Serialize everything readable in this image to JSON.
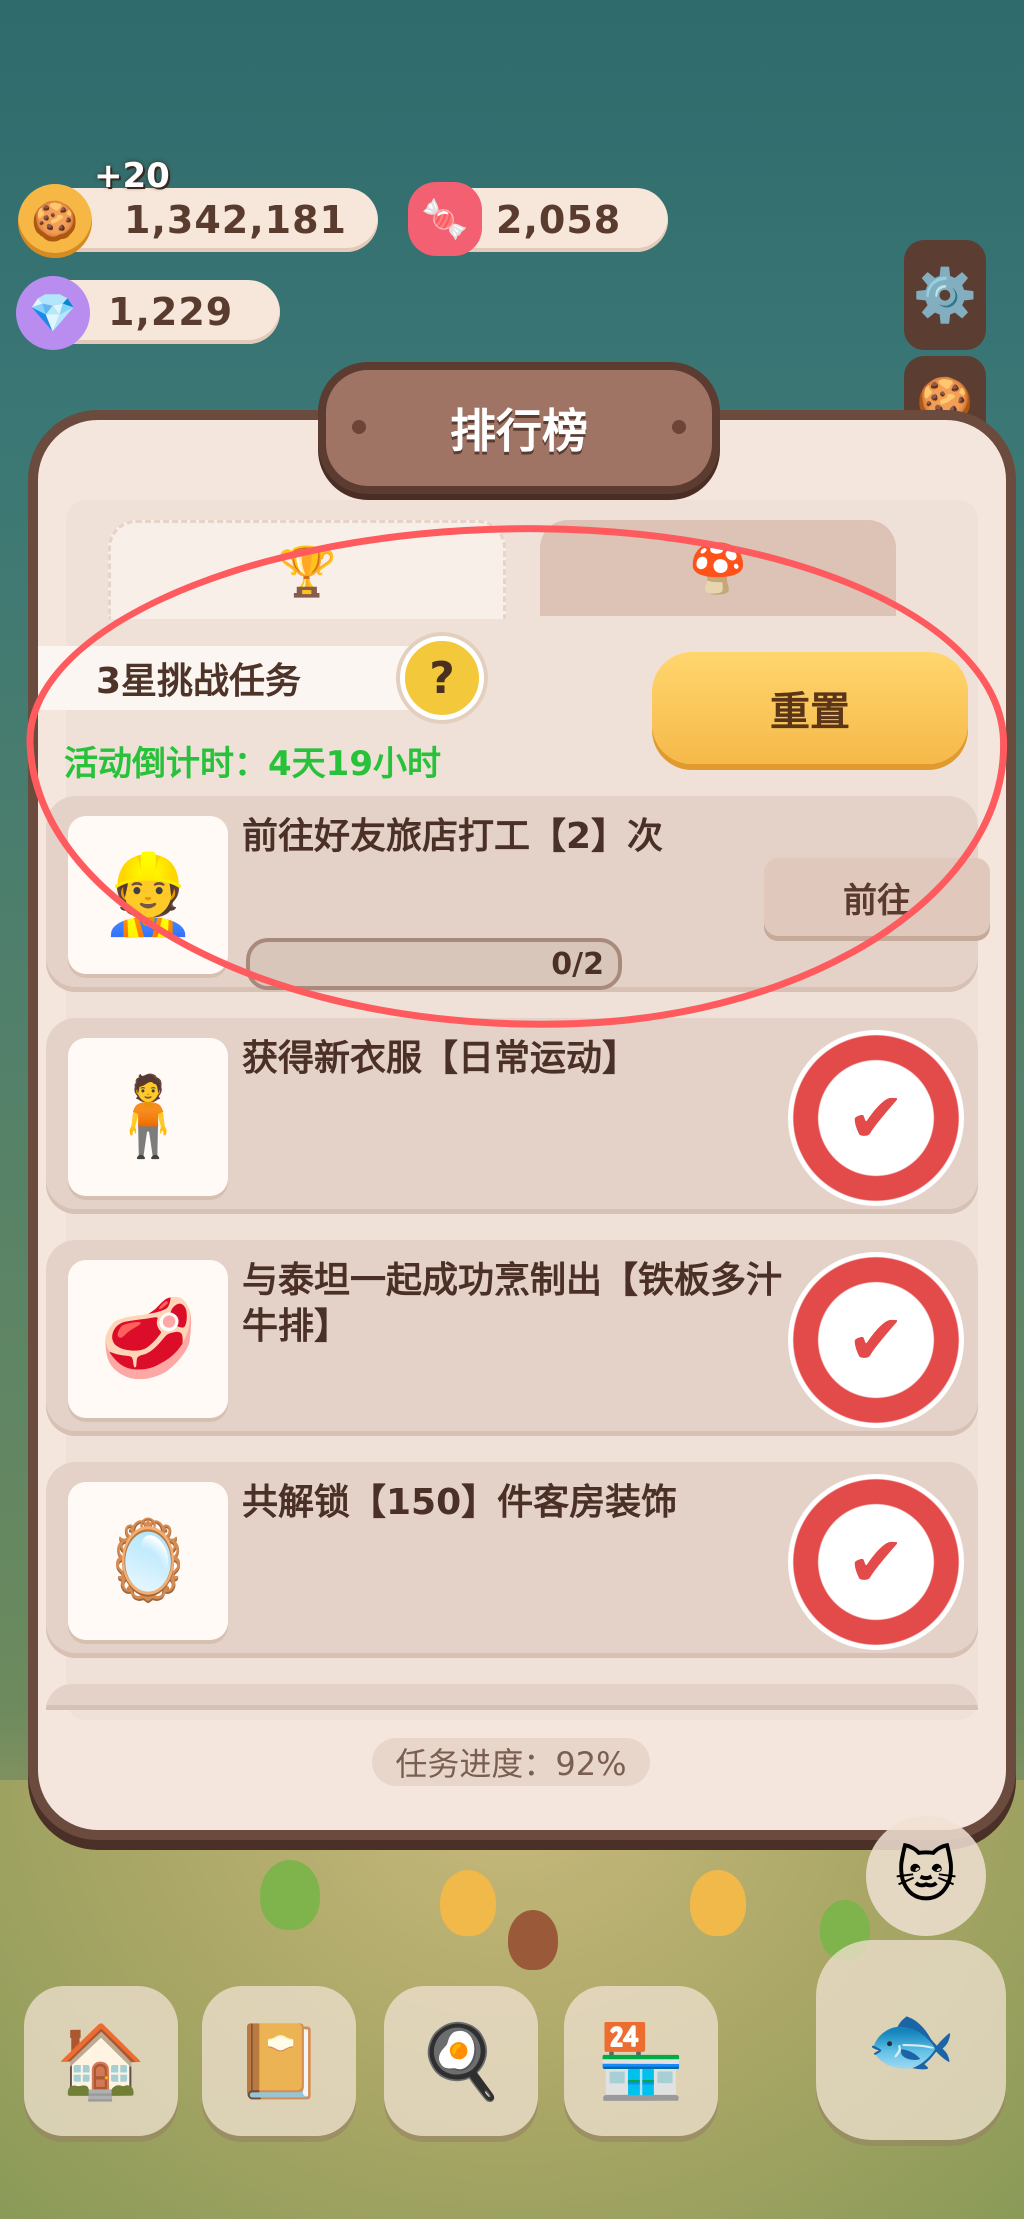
{
  "currency": {
    "bonus": "+20",
    "coins": "1,342,181",
    "gems": "2,058",
    "crystals": "1,229"
  },
  "panel": {
    "title": "排行榜",
    "tabs": [
      {
        "icon": "trophy-icon",
        "glyph": "🏆"
      },
      {
        "icon": "mushroom-icon",
        "glyph": "🍄"
      }
    ]
  },
  "challenge": {
    "title": "3星挑战任务",
    "help_glyph": "?",
    "reset_label": "重置",
    "countdown": "活动倒计时：4天19小时"
  },
  "tasks": [
    {
      "name": "前往好友旅店打工【2】次",
      "glyph": "👷",
      "action": "前往",
      "progress": "0/2",
      "progress_value": 0
    },
    {
      "name": "获得新衣服【日常运动】",
      "glyph": "🧍",
      "status": "completed"
    },
    {
      "name": "与泰坦一起成功烹制出【铁板多汁牛排】",
      "glyph": "🥩",
      "status": "completed"
    },
    {
      "name": "共解锁【150】件客房装饰",
      "glyph": "🪞",
      "status": "completed"
    }
  ],
  "task_progress": "任务进度：92%",
  "dock": [
    {
      "name": "mushroom-house-icon",
      "glyph": "🏠"
    },
    {
      "name": "notebook-icon",
      "glyph": "📔"
    },
    {
      "name": "chef-portrait-icon",
      "glyph": "🍳"
    },
    {
      "name": "shop-stall-icon",
      "glyph": "🏪"
    },
    {
      "name": "fish-clock-icon",
      "glyph": "🐟"
    }
  ]
}
